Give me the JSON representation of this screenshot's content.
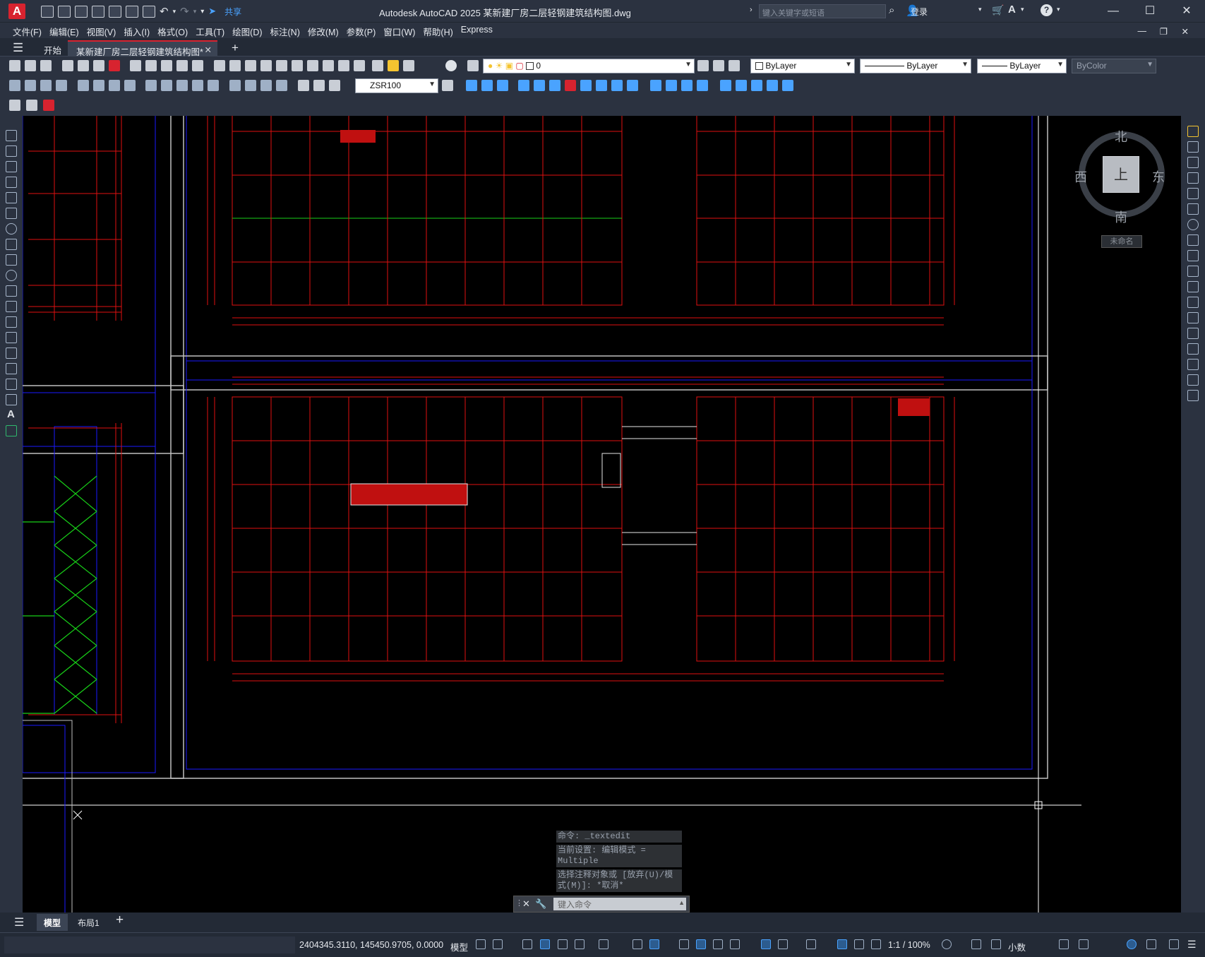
{
  "app": {
    "title": "Autodesk AutoCAD 2025    某新建厂房二层轻钢建筑结构图.dwg",
    "logo_letter": "A",
    "share_label": "共享",
    "search_placeholder": "键入关键字或短语",
    "login_label": "登录",
    "window_controls": [
      "—",
      "☐",
      "✕"
    ],
    "accent_color": "#d8232f"
  },
  "menu": [
    "文件(F)",
    "编辑(E)",
    "视图(V)",
    "插入(I)",
    "格式(O)",
    "工具(T)",
    "绘图(D)",
    "标注(N)",
    "修改(M)",
    "参数(P)",
    "窗口(W)",
    "帮助(H)",
    "Express"
  ],
  "doc_tabs": {
    "start": "开始",
    "active": "某新建厂房二层轻钢建筑结构图*",
    "close": "✕",
    "new": "+"
  },
  "properties": {
    "layer": "0",
    "color": "ByLayer",
    "linetype": "ByLayer",
    "lineweight": "ByLayer",
    "plotstyle": "ByColor",
    "dimstyle": "ZSR100"
  },
  "viewcube": {
    "north": "北",
    "south": "南",
    "east": "东",
    "west": "西",
    "face": "上",
    "wcs": "未命名"
  },
  "command": {
    "history": [
      "命令: _textedit",
      "当前设置: 编辑模式 = Multiple",
      "选择注释对象或 [放弃(U)/模式(M)]: *取消*"
    ],
    "placeholder": "键入命令"
  },
  "layout_tabs": {
    "model": "模型",
    "layout1": "布局1",
    "add": "+"
  },
  "status": {
    "coords": "2404345.3110, 145450.9705, 0.0000",
    "space": "模型",
    "scale": "1:1 / 100%",
    "units": "小数"
  }
}
